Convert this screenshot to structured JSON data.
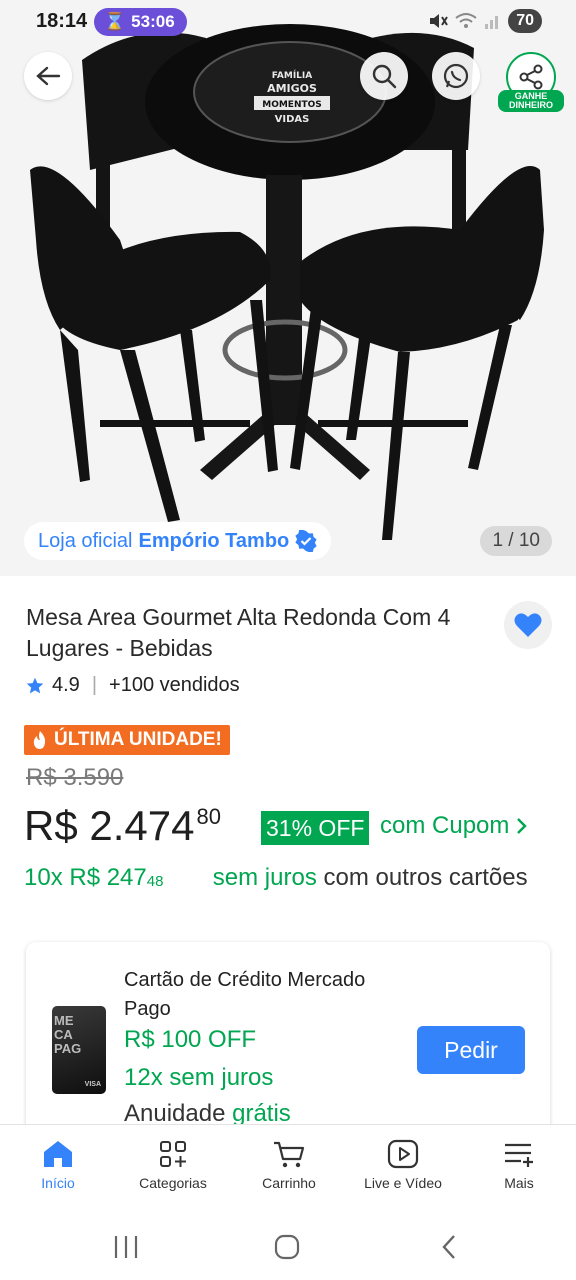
{
  "status_bar": {
    "time": "18:14",
    "timer": "53:06",
    "battery": "70"
  },
  "hero": {
    "table_text": [
      "FAMÍLIA",
      "AMIGOS",
      "MOMENTOS",
      "VIDAS"
    ],
    "seller_prefix": "Loja oficial",
    "seller_name": "Empório Tambo",
    "image_counter": "1 / 10",
    "share_badge": "GANHE DINHEIRO"
  },
  "product": {
    "title": "Mesa Area Gourmet Alta Redonda Com 4 Lugares - Bebidas",
    "rating": "4.9",
    "sold": "+100 vendidos",
    "urgency": "ÚLTIMA UNIDADE!",
    "old_price": "R$ 3.590",
    "price_main": "R$ 2.474",
    "price_cents": "80",
    "discount": "31% OFF",
    "coupon_link": "com Cupom",
    "installments_prefix": "10x R$ 247",
    "installments_cents": "48",
    "installments_green": "sem juros",
    "installments_rest": "com outros cartões"
  },
  "credit_card": {
    "card_text": "ME\nCA\nPAG",
    "card_brand": "VISA",
    "title": "Cartão de Crédito Mercado Pago",
    "off": "R$ 100 OFF",
    "installments": "12x sem juros",
    "annual_prefix": "Anuidade",
    "annual_green": "grátis",
    "button": "Pedir"
  },
  "bottom_nav": [
    {
      "label": "Início",
      "icon": "home-icon",
      "active": true
    },
    {
      "label": "Categorias",
      "icon": "categories-icon",
      "active": false
    },
    {
      "label": "Carrinho",
      "icon": "cart-icon",
      "active": false
    },
    {
      "label": "Live e Vídeo",
      "icon": "play-video-icon",
      "active": false
    },
    {
      "label": "Mais",
      "icon": "menu-plus-icon",
      "active": false
    }
  ],
  "colors": {
    "accent_blue": "#3483fa",
    "green": "#00a650",
    "orange": "#f26d21",
    "timer_purple": "#6b4fd8"
  }
}
